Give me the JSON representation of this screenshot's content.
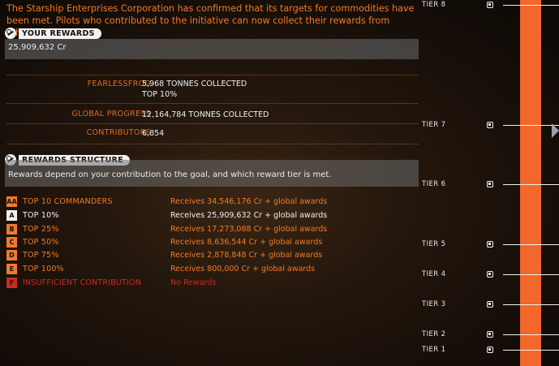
{
  "intro_text": "The Starship Enterprises Corporation has confirmed that its targets for commodities have been met. Pilots who contributed to the initiative can now collect their rewards from Whitson Orbital.",
  "your_rewards": {
    "title": "YOUR REWARDS",
    "value": "25,909,632 Cr"
  },
  "stats": {
    "player": {
      "label": "FEARLESSFROG",
      "value": "5,968 TONNES COLLECTED",
      "subvalue": "TOP 10%"
    },
    "global": {
      "label": "GLOBAL PROGRESS",
      "value": "12,164,784 TONNES COLLECTED"
    },
    "contributors": {
      "label": "CONTRIBUTORS",
      "value": "6,854"
    }
  },
  "rewards_structure": {
    "title": "REWARDS STRUCTURE",
    "description": "Rewards depend on your contribution to the goal, and which reward tier is met.",
    "tiers": [
      {
        "badge": "AA",
        "name": "TOP 10 COMMANDERS",
        "reward": "Receives 34,546,176 Cr + global awards",
        "color": "#f07a2a",
        "badge_bg": "#f07a2a",
        "badge_fg": "#111111"
      },
      {
        "badge": "A",
        "name": "TOP 10%",
        "reward": "Receives 25,909,632 Cr + global awards",
        "color": "#f0f0f0",
        "badge_bg": "#f0f0f0",
        "badge_fg": "#111111"
      },
      {
        "badge": "B",
        "name": "TOP 25%",
        "reward": "Receives 17,273,088 Cr + global awards",
        "color": "#f07a2a",
        "badge_bg": "#f07a2a",
        "badge_fg": "#111111"
      },
      {
        "badge": "C",
        "name": "TOP 50%",
        "reward": "Receives 8,636,544 Cr + global awards",
        "color": "#f07a2a",
        "badge_bg": "#f07a2a",
        "badge_fg": "#111111"
      },
      {
        "badge": "D",
        "name": "TOP 75%",
        "reward": "Receives 2,878,848 Cr + global awards",
        "color": "#f07a2a",
        "badge_bg": "#f07a2a",
        "badge_fg": "#111111"
      },
      {
        "badge": "E",
        "name": "TOP 100%",
        "reward": "Receives 800,000 Cr + global awards",
        "color": "#f07a2a",
        "badge_bg": "#f07a2a",
        "badge_fg": "#111111"
      },
      {
        "badge": "F",
        "name": "INSUFFICIENT CONTRIBUTION",
        "reward": "No Rewards",
        "color": "#cc2a1e",
        "badge_bg": "#cc2a1e",
        "badge_fg": "#2a0a06"
      }
    ]
  },
  "tier_markers": [
    {
      "label": "TIER 8"
    },
    {
      "label": "TIER 7"
    },
    {
      "label": "TIER 6"
    },
    {
      "label": "TIER 5"
    },
    {
      "label": "TIER 4"
    },
    {
      "label": "TIER 3"
    },
    {
      "label": "TIER 2"
    },
    {
      "label": "TIER 1"
    }
  ],
  "colors": {
    "accent": "#f07a2a",
    "tier_bar": "#f2672a",
    "panel": "#6e6e6e"
  }
}
